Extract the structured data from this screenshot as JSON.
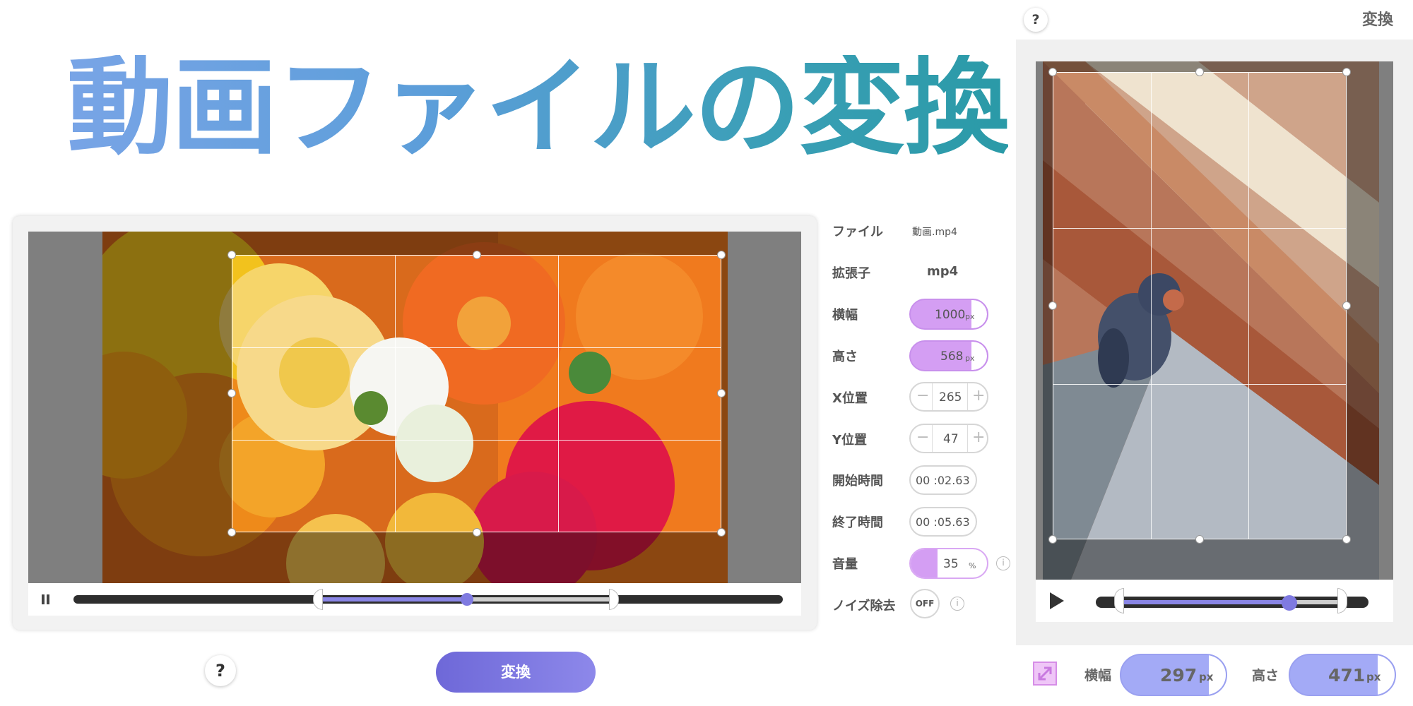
{
  "hero": {
    "title": "動画ファイルの変換"
  },
  "form": {
    "file_label": "ファイル",
    "file_value": "動画.mp4",
    "ext_label": "拡張子",
    "ext_value": "mp4",
    "width_label": "横幅",
    "width_value": "1000",
    "height_label": "高さ",
    "height_value": "568",
    "px_unit": "px",
    "x_label": "X位置",
    "x_value": "265",
    "y_label": "Y位置",
    "y_value": "47",
    "stepper_minus": "−",
    "stepper_plus": "+",
    "start_label": "開始時間",
    "start_value": "00 :02.63",
    "end_label": "終了時間",
    "end_value": "00 :05.63",
    "volume_label": "音量",
    "volume_value": "35",
    "volume_unit": "%",
    "noise_label": "ノイズ除去",
    "noise_value": "OFF",
    "info_glyph": "i"
  },
  "bottom": {
    "help": "?",
    "convert": "変換"
  },
  "phone": {
    "help": "?",
    "title": "変換",
    "width_label": "横幅",
    "width_value": "297",
    "height_label": "高さ",
    "height_value": "471",
    "unit": "px"
  },
  "icons": {
    "pause": "pause-icon",
    "play": "play-icon",
    "info": "info-icon",
    "resize": "resize-icon"
  },
  "colors": {
    "accent_violet": "#d49ef3",
    "accent_blue": "#a3aaf6",
    "button": "#7a74e0",
    "title_start": "#78a4e6",
    "title_end": "#2a9aa7"
  },
  "timeline": {
    "left_playhead_fraction": 0.5,
    "right_playhead_fraction": 0.75
  }
}
